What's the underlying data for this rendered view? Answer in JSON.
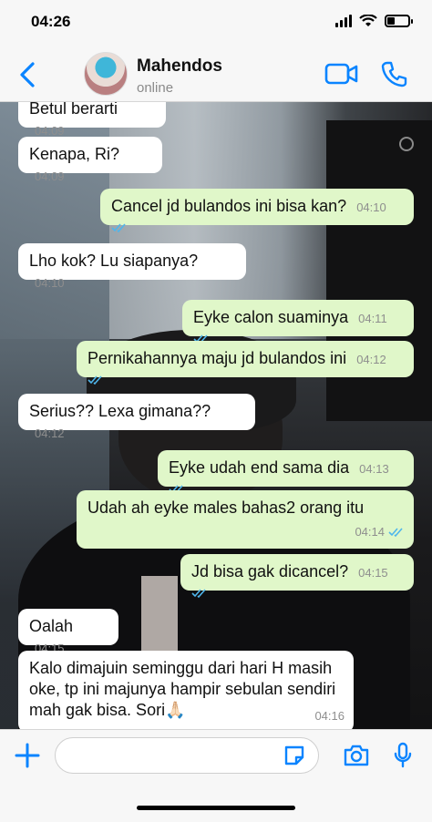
{
  "status_bar": {
    "time": "04:26",
    "battery_level": 0.35
  },
  "header": {
    "back_icon": "chevron-left-icon",
    "contact_name": "Mahendos",
    "contact_status": "online",
    "video_icon": "video-camera-icon",
    "call_icon": "phone-icon",
    "accent_color": "#0a84ff"
  },
  "messages": [
    {
      "direction": "in",
      "text": "Betul berarti",
      "time": "04:09"
    },
    {
      "direction": "in",
      "text": "Kenapa, Ri?",
      "time": "04:09"
    },
    {
      "direction": "out",
      "text": "Cancel jd bulandos ini bisa kan?",
      "time": "04:10",
      "read": true
    },
    {
      "direction": "in",
      "text": "Lho kok? Lu siapanya?",
      "time": "04:10"
    },
    {
      "direction": "out",
      "text": "Eyke calon suaminya",
      "time": "04:11",
      "read": true
    },
    {
      "direction": "out",
      "text": "Pernikahannya maju jd bulandos ini",
      "time": "04:12",
      "read": true
    },
    {
      "direction": "in",
      "text": "Serius?? Lexa gimana??",
      "time": "04:12"
    },
    {
      "direction": "out",
      "text": "Eyke udah end sama dia",
      "time": "04:13",
      "read": true
    },
    {
      "direction": "out",
      "text": "Udah ah eyke males bahas2 orang itu",
      "time": "04:14",
      "read": true
    },
    {
      "direction": "out",
      "text": "Jd bisa gak dicancel?",
      "time": "04:15",
      "read": true
    },
    {
      "direction": "in",
      "text": "Oalah",
      "time": "04:15"
    },
    {
      "direction": "in",
      "text": "Kalo dimajuin seminggu dari hari H masih oke, tp ini majunya hampir sebulan sendiri mah gak bisa. Sori🙏🏻",
      "time": "04:16"
    }
  ],
  "input_bar": {
    "plus_icon": "plus-icon",
    "sticker_icon": "sticker-icon",
    "camera_icon": "camera-icon",
    "mic_icon": "microphone-icon"
  },
  "colors": {
    "incoming_bubble": "#ffffff",
    "outgoing_bubble": "#e0f7c9",
    "read_tick": "#4fb6ec"
  }
}
